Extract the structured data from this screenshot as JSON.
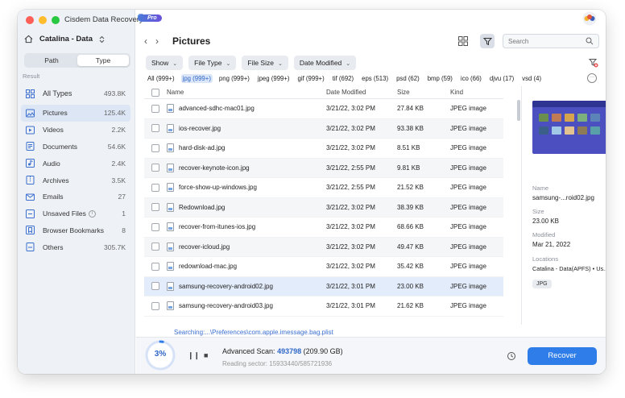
{
  "app": {
    "title": "Cisdem Data Recovery",
    "badge": "Pro"
  },
  "sidebar": {
    "drive": "Catalina - Data",
    "segments": [
      {
        "label": "Path",
        "active": false
      },
      {
        "label": "Type",
        "active": true
      }
    ],
    "result_label": "Result",
    "items": [
      {
        "label": "All Types",
        "count": "493.8K",
        "icon": "grid-icon"
      },
      {
        "label": "Pictures",
        "count": "125.4K",
        "icon": "image-icon"
      },
      {
        "label": "Videos",
        "count": "2.2K",
        "icon": "video-icon"
      },
      {
        "label": "Documents",
        "count": "54.6K",
        "icon": "document-icon"
      },
      {
        "label": "Audio",
        "count": "2.4K",
        "icon": "audio-icon"
      },
      {
        "label": "Archives",
        "count": "3.5K",
        "icon": "archive-icon"
      },
      {
        "label": "Emails",
        "count": "27",
        "icon": "email-icon"
      },
      {
        "label": "Unsaved Files",
        "count": "1",
        "icon": "unsaved-icon"
      },
      {
        "label": "Browser Bookmarks",
        "count": "8",
        "icon": "bookmark-icon"
      },
      {
        "label": "Others",
        "count": "305.7K",
        "icon": "others-icon"
      }
    ]
  },
  "main": {
    "title": "Pictures",
    "search_placeholder": "Search",
    "filters": [
      "Show",
      "File Type",
      "File Size",
      "Date Modified"
    ],
    "type_tabs": [
      "All (999+)",
      "jpg (999+)",
      "png (999+)",
      "jpeg (999+)",
      "gif (999+)",
      "tif (692)",
      "eps (513)",
      "psd (62)",
      "bmp (59)",
      "ico (66)",
      "djvu (17)",
      "vsd (4)"
    ],
    "active_tab": 1,
    "columns": {
      "name": "Name",
      "date": "Date Modified",
      "size": "Size",
      "kind": "Kind"
    },
    "rows": [
      {
        "name": "advanced-sdhc-mac01.jpg",
        "date": "3/21/22, 3:02 PM",
        "size": "27.84 KB",
        "kind": "JPEG image"
      },
      {
        "name": "ios-recover.jpg",
        "date": "3/21/22, 3:02 PM",
        "size": "93.38 KB",
        "kind": "JPEG image"
      },
      {
        "name": "hard-disk-ad.jpg",
        "date": "3/21/22, 3:02 PM",
        "size": "8.51 KB",
        "kind": "JPEG image"
      },
      {
        "name": "recover-keynote-icon.jpg",
        "date": "3/21/22, 2:55 PM",
        "size": "9.81 KB",
        "kind": "JPEG image"
      },
      {
        "name": "force-show-up-windows.jpg",
        "date": "3/21/22, 2:55 PM",
        "size": "21.52 KB",
        "kind": "JPEG image"
      },
      {
        "name": "Redownload.jpg",
        "date": "3/21/22, 3:02 PM",
        "size": "38.39 KB",
        "kind": "JPEG image"
      },
      {
        "name": "recover-from-itunes-ios.jpg",
        "date": "3/21/22, 3:02 PM",
        "size": "68.66 KB",
        "kind": "JPEG image"
      },
      {
        "name": "recover-icloud.jpg",
        "date": "3/21/22, 3:02 PM",
        "size": "49.47 KB",
        "kind": "JPEG image"
      },
      {
        "name": "redownload-mac.jpg",
        "date": "3/21/22, 3:02 PM",
        "size": "35.42 KB",
        "kind": "JPEG image"
      },
      {
        "name": "samsung-recovery-android02.jpg",
        "date": "3/21/22, 3:01 PM",
        "size": "23.00 KB",
        "kind": "JPEG image"
      },
      {
        "name": "samsung-recovery-android03.jpg",
        "date": "3/21/22, 3:01 PM",
        "size": "21.62 KB",
        "kind": "JPEG image"
      }
    ],
    "selected_row": 9
  },
  "preview": {
    "name_label": "Name",
    "name": "samsung-...roid02.jpg",
    "size_label": "Size",
    "size": "23.00 KB",
    "modified_label": "Modified",
    "modified": "Mar 21, 2022",
    "locations_label": "Locations",
    "location": "Catalina - Data(APFS) • Us...jpg",
    "tag": "JPG"
  },
  "footer": {
    "searching": "Searching:...\\Preferences\\com.apple.imessage.bag.plist",
    "progress_percent": 3,
    "progress_text": "3%",
    "scan_label": "Advanced Scan:",
    "scan_count": "493798",
    "scan_size": "(209.90 GB)",
    "sector": "Reading sector: 15933440/585721936",
    "recover_label": "Recover"
  },
  "colors": {
    "accent": "#2f7de8",
    "selected_row": "#e3ecfa",
    "sidebar_bg": "#eef1f6"
  }
}
